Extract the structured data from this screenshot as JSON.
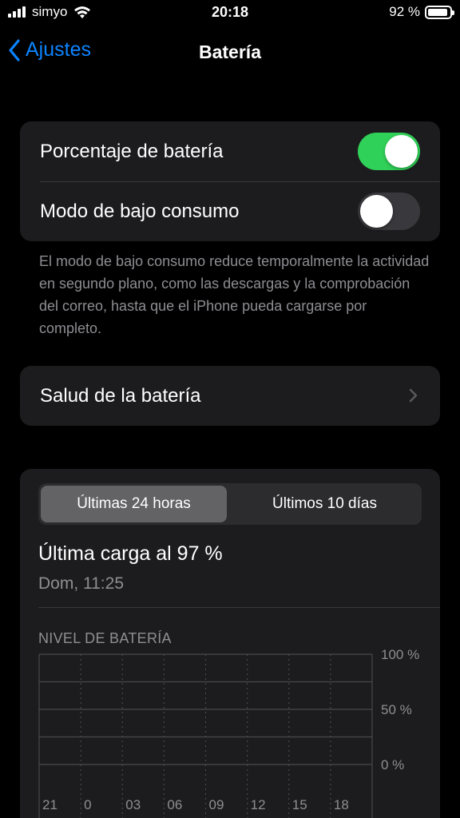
{
  "status_bar": {
    "carrier": "simyo",
    "time": "20:18",
    "battery_percent_text": "92 %",
    "battery_level": 0.92,
    "icons": [
      "signal-icon",
      "wifi-icon",
      "battery-icon"
    ]
  },
  "nav": {
    "back_label": "Ajustes",
    "title": "Batería"
  },
  "settings": {
    "battery_percentage": {
      "label": "Porcentaje de batería",
      "on": true
    },
    "low_power_mode": {
      "label": "Modo de bajo consumo",
      "on": false
    },
    "footnote": "El modo de bajo consumo reduce temporalmente la actividad en segundo plano, como las descargas y la comprobación del correo, hasta que el iPhone pueda cargarse por completo.",
    "battery_health": {
      "label": "Salud de la batería"
    }
  },
  "usage": {
    "tabs": [
      {
        "label": "Últimas 24 horas",
        "active": true
      },
      {
        "label": "Últimos 10 días",
        "active": false
      }
    ],
    "last_charge": "Última carga al 97 %",
    "last_charge_date": "Dom, 11:25"
  },
  "chart_data": {
    "type": "bar",
    "title": "NIVEL DE BATERÍA",
    "categories": [
      "21",
      "0",
      "03",
      "06",
      "09",
      "12",
      "15",
      "18"
    ],
    "y_tick_labels": [
      "100 %",
      "50 %",
      "0 %"
    ],
    "ylim": [
      0,
      100
    ],
    "grid": true,
    "values": []
  },
  "colors": {
    "accent": "#0a84ff",
    "toggle_on": "#30d158",
    "secondary_text": "#8e8e93",
    "group_bg": "#1c1c1e"
  }
}
